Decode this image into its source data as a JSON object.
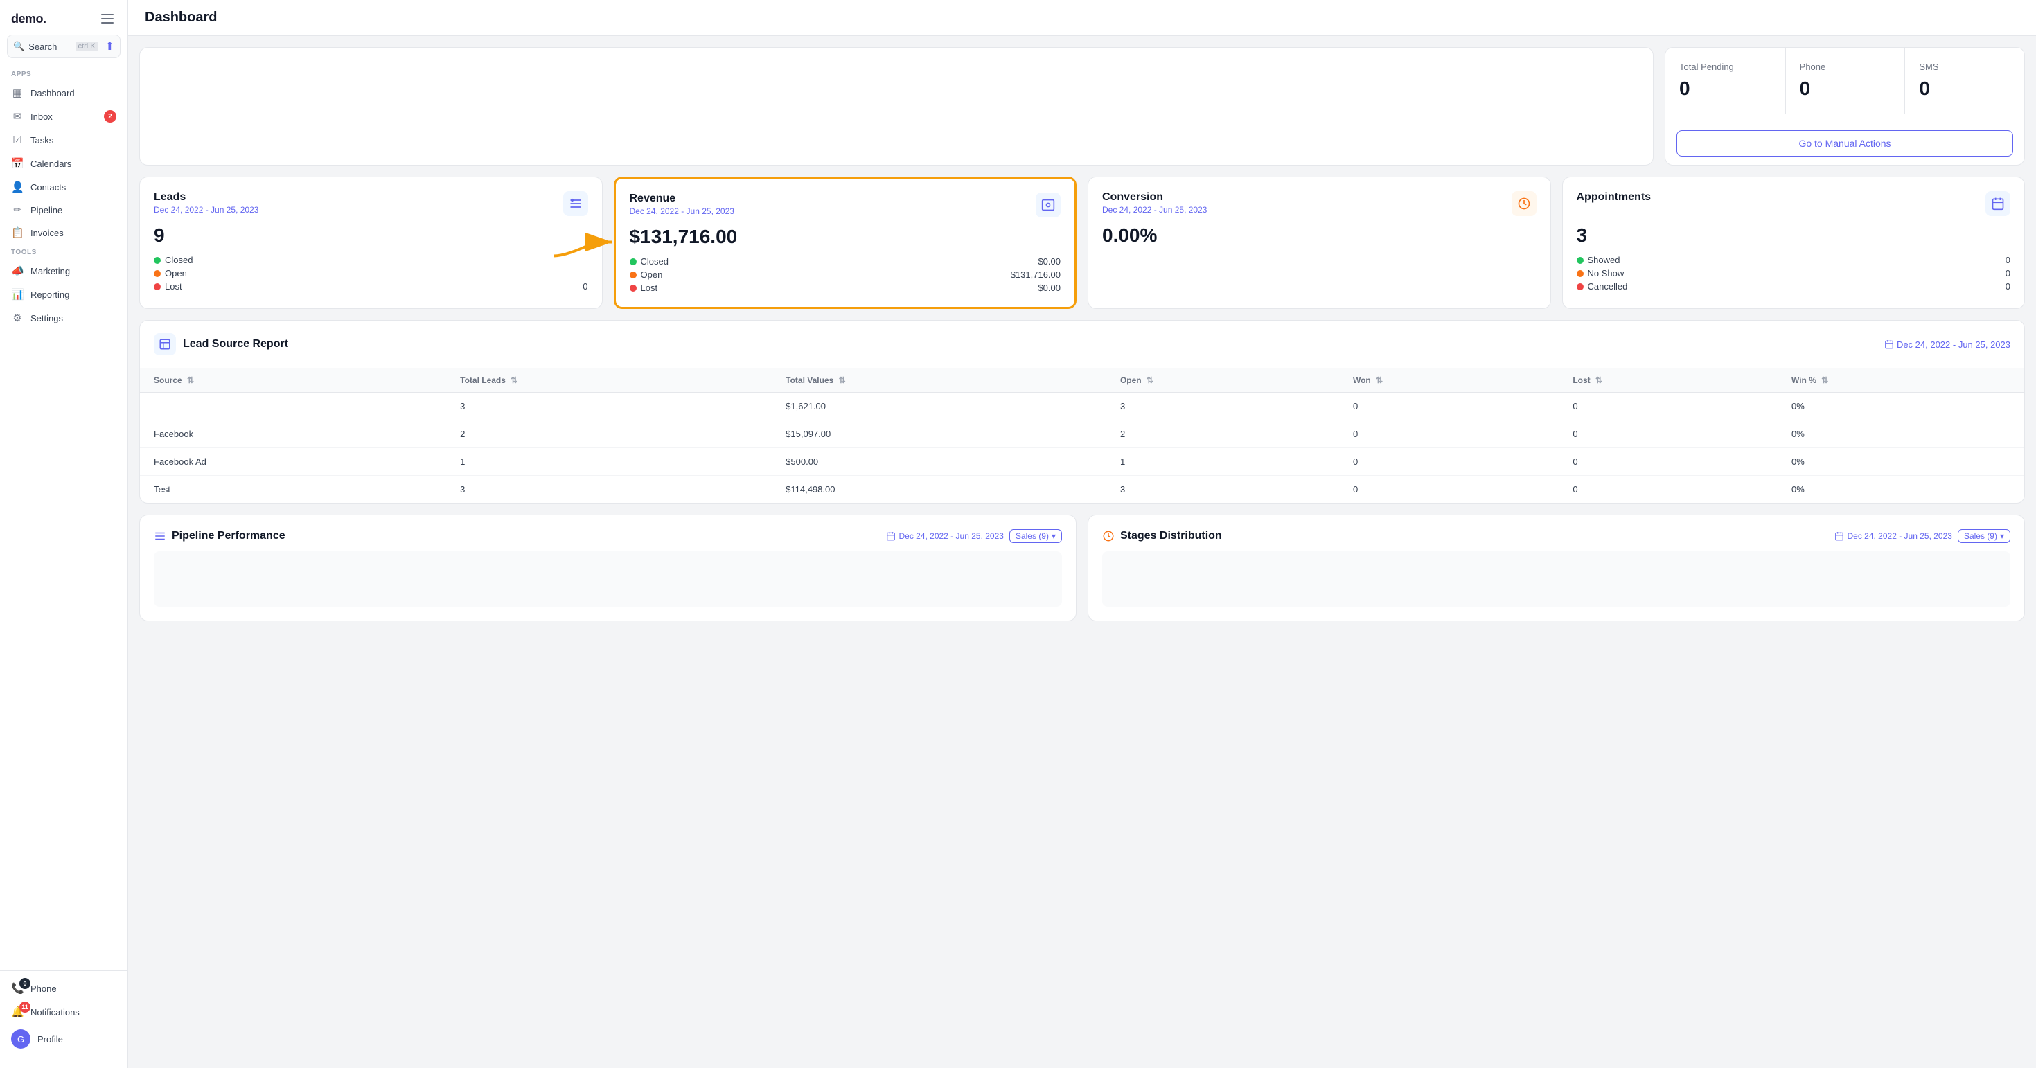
{
  "app": {
    "logo": "demo.",
    "logo_dot": "."
  },
  "topbar": {
    "title": "Dashboard",
    "hamburger_label": "menu"
  },
  "sidebar": {
    "search_label": "Search",
    "search_shortcut": "ctrl K",
    "sections": [
      {
        "label": "Apps",
        "items": [
          {
            "id": "dashboard",
            "label": "Dashboard",
            "icon": "▦"
          },
          {
            "id": "inbox",
            "label": "Inbox",
            "icon": "✉",
            "badge": "2"
          },
          {
            "id": "tasks",
            "label": "Tasks",
            "icon": "✓"
          },
          {
            "id": "calendars",
            "label": "Calendars",
            "icon": "📅"
          },
          {
            "id": "contacts",
            "label": "Contacts",
            "icon": "👤"
          },
          {
            "id": "pipeline",
            "label": "Pipeline",
            "icon": "⚡"
          },
          {
            "id": "invoices",
            "label": "Invoices",
            "icon": "📄"
          }
        ]
      },
      {
        "label": "Tools",
        "items": [
          {
            "id": "marketing",
            "label": "Marketing",
            "icon": "📣"
          },
          {
            "id": "reporting",
            "label": "Reporting",
            "icon": "📊"
          },
          {
            "id": "settings",
            "label": "Settings",
            "icon": "⚙"
          }
        ]
      }
    ],
    "bottom": [
      {
        "id": "phone",
        "label": "Phone",
        "icon": "📞",
        "badge": "0"
      },
      {
        "id": "notifications",
        "label": "Notifications",
        "icon": "🔔",
        "badge": "11"
      },
      {
        "id": "profile",
        "label": "Profile",
        "icon": "😊",
        "badge": ""
      }
    ]
  },
  "top_stats": {
    "label1": "Total Pending",
    "value1": "0",
    "label2": "Phone",
    "value2": "0",
    "label3": "SMS",
    "value3": "0",
    "cta": "Go to Manual Actions"
  },
  "leads_card": {
    "title": "Leads",
    "date_range": "Dec 24, 2022 - Jun 25, 2023",
    "value": "9",
    "stats": [
      {
        "label": "Closed",
        "color": "green",
        "value": ""
      },
      {
        "label": "Open",
        "color": "orange",
        "value": ""
      },
      {
        "label": "Lost",
        "color": "red",
        "value": "0"
      }
    ]
  },
  "revenue_card": {
    "title": "Revenue",
    "date_range": "Dec 24, 2022 - Jun 25, 2023",
    "value": "$131,716.00",
    "stats": [
      {
        "label": "Closed",
        "color": "green",
        "value": "$0.00"
      },
      {
        "label": "Open",
        "color": "orange",
        "value": "$131,716.00"
      },
      {
        "label": "Lost",
        "color": "red",
        "value": "$0.00"
      }
    ]
  },
  "conversion_card": {
    "title": "Conversion",
    "date_range": "Dec 24, 2022 - Jun 25, 2023",
    "value": "0.00%"
  },
  "appointments_card": {
    "title": "Appointments",
    "date_range": "",
    "value": "3",
    "stats": [
      {
        "label": "Showed",
        "color": "green",
        "value": "0"
      },
      {
        "label": "No Show",
        "color": "orange",
        "value": "0"
      },
      {
        "label": "Cancelled",
        "color": "red",
        "value": "0"
      }
    ]
  },
  "lead_source_report": {
    "title": "Lead Source Report",
    "date_range": "Dec 24, 2022 - Jun 25, 2023",
    "columns": [
      "Source",
      "Total Leads",
      "Total Values",
      "Open",
      "Won",
      "Lost",
      "Win %"
    ],
    "rows": [
      {
        "source": "",
        "total_leads": "3",
        "total_values": "$1,621.00",
        "open": "3",
        "won": "0",
        "lost": "0",
        "win_pct": "0%"
      },
      {
        "source": "Facebook",
        "total_leads": "2",
        "total_values": "$15,097.00",
        "open": "2",
        "won": "0",
        "lost": "0",
        "win_pct": "0%"
      },
      {
        "source": "Facebook Ad",
        "total_leads": "1",
        "total_values": "$500.00",
        "open": "1",
        "won": "0",
        "lost": "0",
        "win_pct": "0%"
      },
      {
        "source": "Test",
        "total_leads": "3",
        "total_values": "$114,498.00",
        "open": "3",
        "won": "0",
        "lost": "0",
        "win_pct": "0%"
      }
    ]
  },
  "pipeline_performance": {
    "title": "Pipeline Performance",
    "date_range": "Dec 24, 2022 - Jun 25, 2023",
    "filter": "Sales (9)"
  },
  "stages_distribution": {
    "title": "Stages Distribution",
    "date_range": "Dec 24, 2022 - Jun 25, 2023",
    "filter": "Sales (9)"
  },
  "colors": {
    "accent": "#6366f1",
    "green": "#22c55e",
    "orange": "#f97316",
    "red": "#ef4444",
    "highlight": "#f59e0b",
    "bg": "#f3f4f6"
  }
}
